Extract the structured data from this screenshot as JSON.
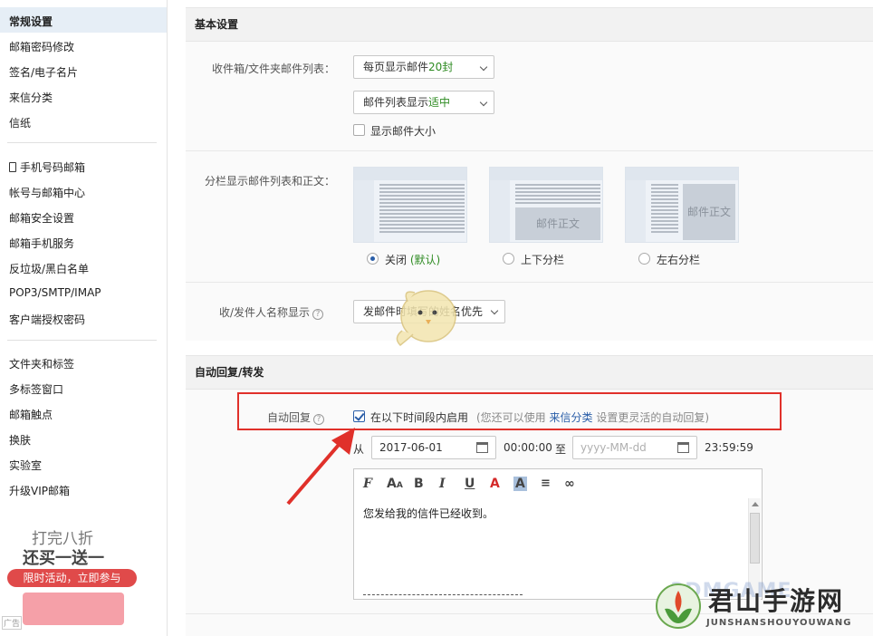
{
  "sidebar": {
    "group1": [
      "常规设置",
      "邮箱密码修改",
      "签名/电子名片",
      "来信分类",
      "信纸"
    ],
    "group2": [
      "手机号码邮箱",
      "帐号与邮箱中心",
      "邮箱安全设置",
      "邮箱手机服务",
      "反垃圾/黑白名单",
      "POP3/SMTP/IMAP",
      "客户端授权密码"
    ],
    "group3": [
      "文件夹和标签",
      "多标签窗口",
      "邮箱触点",
      "换肤",
      "实验室",
      "升级VIP邮箱"
    ],
    "active": "常规设置",
    "ad": {
      "line1": "打完八折",
      "line2": "还买一送一",
      "button": "限时活动，立即参与",
      "tag": "广告"
    }
  },
  "basic": {
    "title": "基本设置",
    "inbox_label": "收件箱/文件夹邮件列表：",
    "per_page_prefix": "每页显示邮件",
    "per_page_value": "20封",
    "density_prefix": "邮件列表显示",
    "density_value": "适中",
    "show_size": "显示邮件大小",
    "split_label": "分栏显示邮件列表和正文：",
    "layouts": [
      {
        "label": "关闭",
        "note": "(默认)",
        "selected": true,
        "pane_text": ""
      },
      {
        "label": "上下分栏",
        "note": "",
        "selected": false,
        "pane_text": "邮件正文"
      },
      {
        "label": "左右分栏",
        "note": "",
        "selected": false,
        "pane_text": "邮件正文"
      }
    ],
    "sender_label": "收/发件人名称显示",
    "sender_value": "发邮件时填写的姓名优先"
  },
  "autoreply": {
    "title": "自动回复/转发",
    "label": "自动回复",
    "enable_text": "在以下时间段内启用",
    "hint_prefix": "(您还可以使用",
    "hint_link": "来信分类",
    "hint_suffix": "设置更灵活的自动回复)",
    "from": "从",
    "start_date": "2017-06-01",
    "start_time": "00:00:00",
    "to": "至",
    "end_placeholder": "yyyy-MM-dd",
    "end_time": "23:59:59",
    "body": "您发给我的信件已经收到。",
    "toolbar": [
      "font-icon",
      "font-size-icon",
      "bold-icon",
      "italic-icon",
      "underline-icon",
      "font-color-icon",
      "bg-color-icon",
      "align-icon",
      "link-icon"
    ]
  },
  "watermark": {
    "title": "君山手游网",
    "sub": "JUNSHANSHOUYOUWANG",
    "ghost": "3DMGAME"
  },
  "colors": {
    "accent": "#2a5ea8",
    "highlight": "#e0302a",
    "green": "#2e8b22",
    "link": "#2a5ea8"
  }
}
